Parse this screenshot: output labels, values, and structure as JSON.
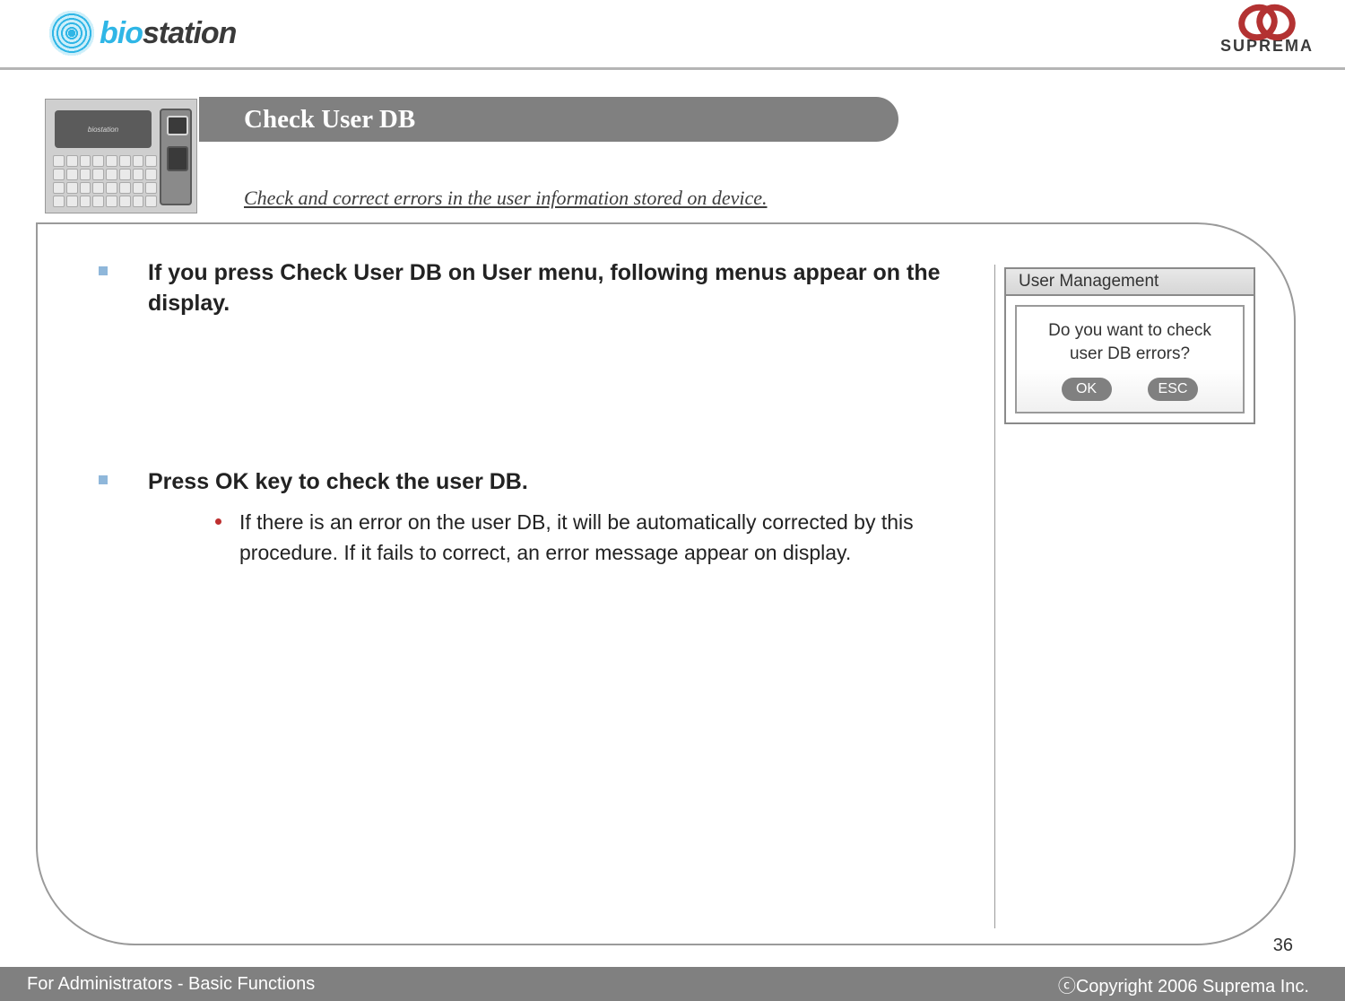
{
  "header": {
    "product_prefix": "bi",
    "product_middle": "o",
    "product_suffix": "station",
    "company": "SUPREMA"
  },
  "title": "Check User DB",
  "subtitle": "Check and correct errors in the user information stored on device.",
  "bullets": {
    "b1": "If you press Check User DB on User menu, following menus appear on the display.",
    "b2": "Press OK key to check the user DB.",
    "b2_sub": "If there is an error on the user DB, it will be automatically corrected by this procedure. If it fails to correct, an error message appear on display."
  },
  "dialog": {
    "title": "User Management",
    "question_line1": "Do you want to check",
    "question_line2": "user DB errors?",
    "ok": "OK",
    "esc": "ESC"
  },
  "footer": {
    "left": "For Administrators - Basic Functions",
    "right": "ⓒCopyright 2006 Suprema Inc."
  },
  "page": "36"
}
